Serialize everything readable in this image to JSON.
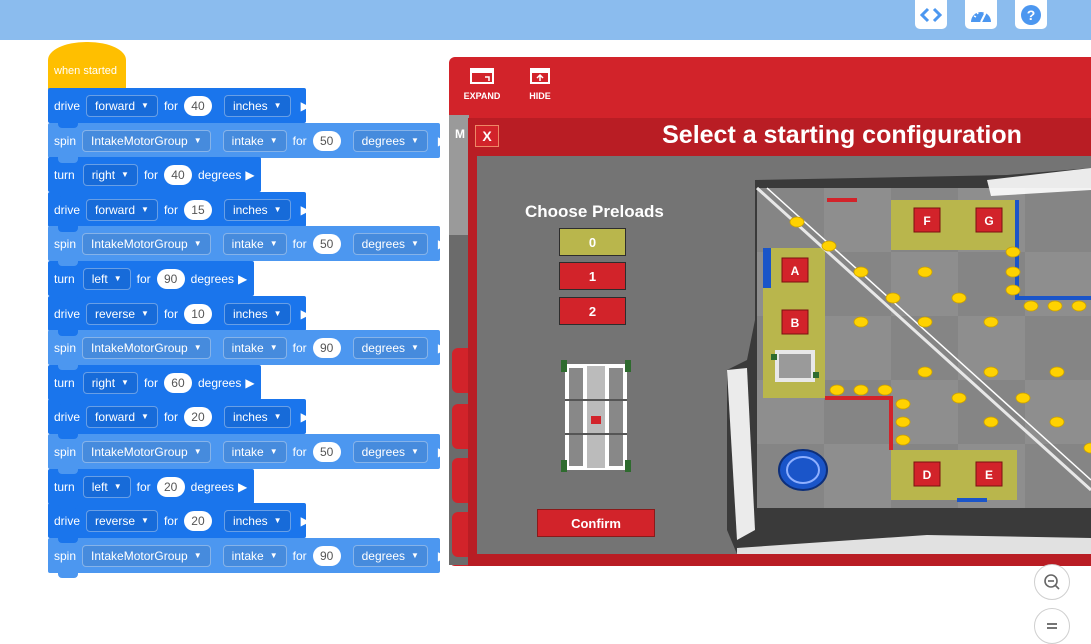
{
  "toolbar": {
    "icons": [
      "code-icon",
      "dashboard-icon",
      "help-icon"
    ],
    "help_label": "?"
  },
  "program": {
    "hat_label": "when started",
    "blocks": [
      {
        "kind": "drive",
        "verb": "drive",
        "dir": "forward",
        "for": "for",
        "value": "40",
        "unit": "inches"
      },
      {
        "kind": "spin",
        "verb": "spin",
        "motor": "IntakeMotorGroup",
        "dir": "intake",
        "for": "for",
        "value": "50",
        "unit": "degrees"
      },
      {
        "kind": "turn",
        "verb": "turn",
        "dir": "right",
        "for": "for",
        "value": "40",
        "unit": "degrees"
      },
      {
        "kind": "drive",
        "verb": "drive",
        "dir": "forward",
        "for": "for",
        "value": "15",
        "unit": "inches"
      },
      {
        "kind": "spin",
        "verb": "spin",
        "motor": "IntakeMotorGroup",
        "dir": "intake",
        "for": "for",
        "value": "50",
        "unit": "degrees"
      },
      {
        "kind": "turn",
        "verb": "turn",
        "dir": "left",
        "for": "for",
        "value": "90",
        "unit": "degrees"
      },
      {
        "kind": "drive",
        "verb": "drive",
        "dir": "reverse",
        "for": "for",
        "value": "10",
        "unit": "inches"
      },
      {
        "kind": "spin",
        "verb": "spin",
        "motor": "IntakeMotorGroup",
        "dir": "intake",
        "for": "for",
        "value": "90",
        "unit": "degrees"
      },
      {
        "kind": "turn",
        "verb": "turn",
        "dir": "right",
        "for": "for",
        "value": "60",
        "unit": "degrees"
      },
      {
        "kind": "drive",
        "verb": "drive",
        "dir": "forward",
        "for": "for",
        "value": "20",
        "unit": "inches"
      },
      {
        "kind": "spin",
        "verb": "spin",
        "motor": "IntakeMotorGroup",
        "dir": "intake",
        "for": "for",
        "value": "50",
        "unit": "degrees"
      },
      {
        "kind": "turn",
        "verb": "turn",
        "dir": "left",
        "for": "for",
        "value": "20",
        "unit": "degrees"
      },
      {
        "kind": "drive",
        "verb": "drive",
        "dir": "reverse",
        "for": "for",
        "value": "20",
        "unit": "inches"
      },
      {
        "kind": "spin",
        "verb": "spin",
        "motor": "IntakeMotorGroup",
        "dir": "intake",
        "for": "for",
        "value": "90",
        "unit": "degrees"
      }
    ]
  },
  "playground": {
    "expand_label": "EXPAND",
    "hide_label": "HIDE",
    "behind_label": "M"
  },
  "modal": {
    "close_label": "X",
    "title": "Select a starting configuration",
    "preloads_heading": "Choose Preloads",
    "preload_options": [
      "0",
      "1",
      "2"
    ],
    "selected_preload": "0",
    "confirm_label": "Confirm",
    "start_positions": [
      "A",
      "B",
      "D",
      "E",
      "F",
      "G"
    ]
  },
  "colors": {
    "topbar": "#8bbcee",
    "hat": "#ffbf00",
    "drive_block": "#1a75ec",
    "spin_block": "#4c97f0",
    "panel_red": "#d2232a",
    "selected_preload": "#b9b64c",
    "field_zone": "#b9b64c",
    "ball": "#ffd200"
  }
}
